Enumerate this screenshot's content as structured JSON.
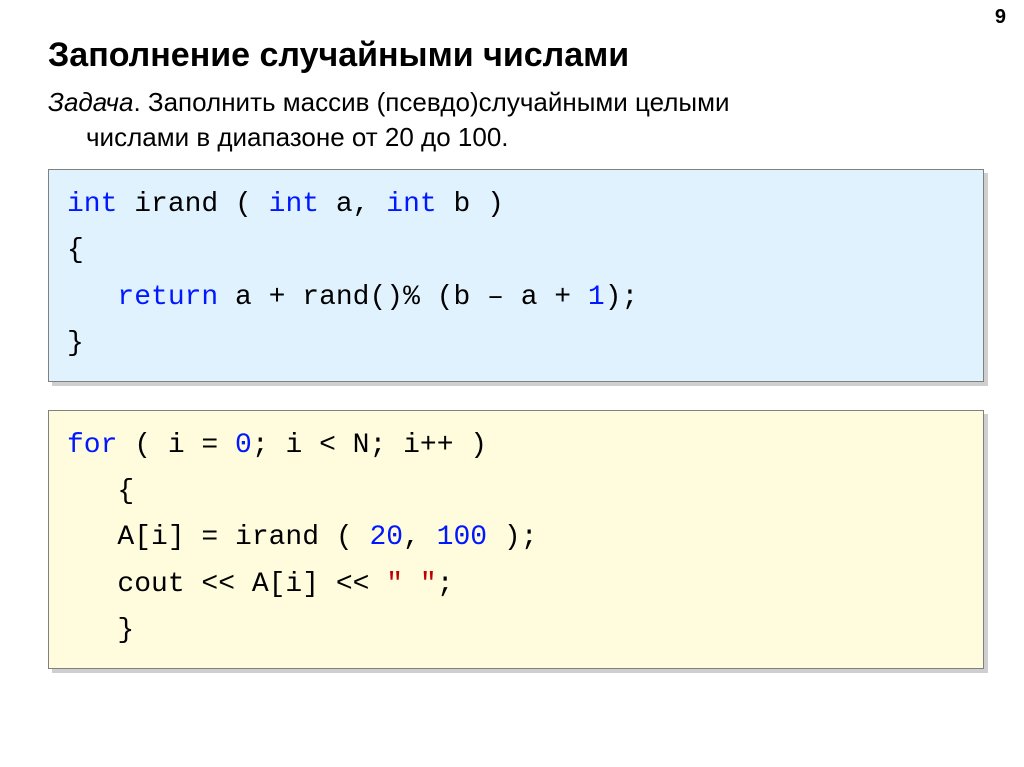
{
  "page_number": "9",
  "title": "Заполнение случайными числами",
  "task": {
    "lead": "Задача",
    "line1_rest": ". Заполнить массив (псевдо)случайными целыми",
    "line2": "числами в диапазоне от 20 до 100."
  },
  "code1": {
    "t0": "int",
    "t1": " irand ( ",
    "t2": "int",
    "t3": " a, ",
    "t4": "int",
    "t5": " b )",
    "t6": "{",
    "t7": "   ",
    "t8": "return",
    "t9": " a + rand()% (b – a + ",
    "t10": "1",
    "t11": ");",
    "t12": "}"
  },
  "code2": {
    "t0": "for",
    "t1": " ( i = ",
    "t2": "0",
    "t3": "; i < N; i++ )",
    "t4": "   {",
    "t5": "   A[i] = irand ( ",
    "t6": "20",
    "t7": ", ",
    "t8": "100",
    "t9": " );",
    "t10": "   cout << A[i] << ",
    "t11": "\" \"",
    "t12": ";",
    "t13": "   }"
  }
}
